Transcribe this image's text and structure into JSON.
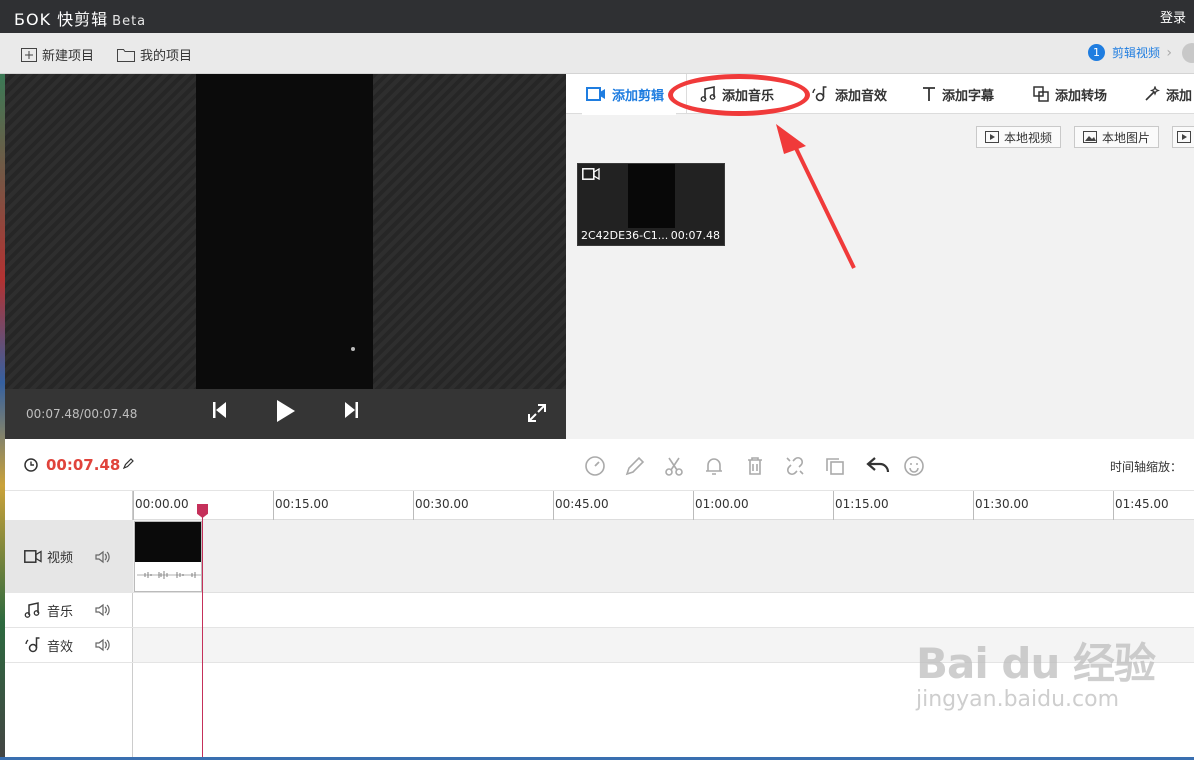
{
  "app": {
    "logo_mark": "ƂOK",
    "title": "快剪辑",
    "beta": "Beta",
    "login": "登录"
  },
  "toolbar": {
    "new_project": "新建项目",
    "my_projects": "我的项目",
    "step_number": "1",
    "step_label": "剪辑视频",
    "step_next": "›"
  },
  "preview": {
    "timecode": "00:07.48/00:07.48"
  },
  "tabs": [
    {
      "label": "添加剪辑",
      "icon": "video-camera-icon"
    },
    {
      "label": "添加音乐",
      "icon": "music-note-icon"
    },
    {
      "label": "添加音效",
      "icon": "sound-effect-icon"
    },
    {
      "label": "添加字幕",
      "icon": "text-icon"
    },
    {
      "label": "添加转场",
      "icon": "transition-icon"
    },
    {
      "label": "添加",
      "icon": "magic-wand-icon"
    }
  ],
  "sources": {
    "local_video": "本地视频",
    "local_image": "本地图片"
  },
  "library": {
    "clip_name": "2C42DE36-C1...",
    "clip_duration": "00:07.48"
  },
  "timeline": {
    "current_time": "00:07.48",
    "zoom_label": "时间轴缩放：",
    "ruler": [
      "00:00.00",
      "00:15.00",
      "00:30.00",
      "00:45.00",
      "01:00.00",
      "01:15.00",
      "01:30.00",
      "01:45.00"
    ]
  },
  "tracks": {
    "video": "视频",
    "music": "音乐",
    "sfx": "音效"
  },
  "annotation_color": "#f03a3a",
  "accent_color": "#1f7de0",
  "time_color": "#e0433b",
  "watermark": {
    "logo": "Bai du 经验",
    "url": "jingyan.baidu.com"
  }
}
